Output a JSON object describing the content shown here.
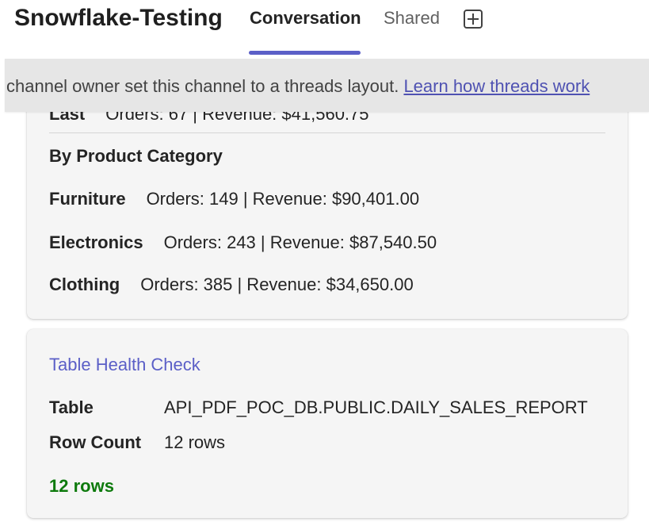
{
  "header": {
    "channel_title": "Snowflake-Testing",
    "tabs": [
      {
        "label": "Conversation",
        "active": true
      },
      {
        "label": "Shared",
        "active": false
      }
    ],
    "add_tab_icon": "add-tab-icon"
  },
  "banner": {
    "text": "channel owner set this channel to a threads layout.",
    "link": "Learn how threads work"
  },
  "sales_card": {
    "partial_row": {
      "label": "Last",
      "value": "Orders: 67 | Revenue: $41,560.75"
    },
    "section_title": "By Product Category",
    "categories": [
      {
        "name": "Furniture",
        "value": "Orders: 149 | Revenue: $90,401.00"
      },
      {
        "name": "Electronics",
        "value": "Orders: 243 | Revenue: $87,540.50"
      },
      {
        "name": "Clothing",
        "value": "Orders: 385 | Revenue: $34,650.00"
      }
    ]
  },
  "health_card": {
    "title": "Table Health Check",
    "rows": [
      {
        "label": "Table",
        "value": "API_PDF_POC_DB.PUBLIC.DAILY_SALES_REPORT"
      },
      {
        "label": "Row Count",
        "value": "12 rows"
      }
    ],
    "status": "12 rows",
    "status_color": "#0e7a0d"
  },
  "colors": {
    "accent": "#5b5fc7",
    "link": "#4f52b2",
    "banner_bg": "#e6e6e6",
    "card_bg": "#f5f5f5"
  }
}
